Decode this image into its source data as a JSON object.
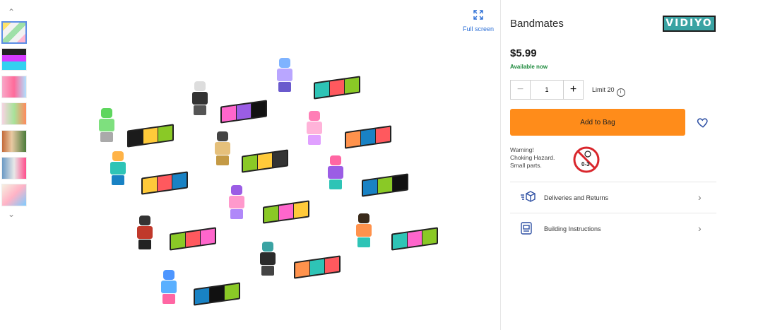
{
  "gallery": {
    "thumbnails": [
      "thumb-1",
      "thumb-2",
      "thumb-3",
      "thumb-4",
      "thumb-5",
      "thumb-6",
      "thumb-7"
    ],
    "up_arrow": "^",
    "down_arrow": "v",
    "fullscreen_label": "Full screen"
  },
  "product": {
    "title": "Bandmates",
    "brand_logo_text": "VIDIYO",
    "price": "$5.99",
    "availability": "Available now",
    "quantity": "1",
    "limit_text": "Limit 20",
    "add_to_bag_label": "Add to Bag",
    "warning_lines": [
      "Warning!",
      "Choking Hazard.",
      "Small parts."
    ],
    "hazard_age_label": "0-3"
  },
  "links": [
    {
      "label": "Deliveries and Returns",
      "icon": "delivery-box-icon"
    },
    {
      "label": "Building Instructions",
      "icon": "instructions-book-icon"
    }
  ],
  "colors": {
    "accent": "#ff8c1a",
    "available": "#1e8a3d",
    "link": "#2d6fd6",
    "brand": "#3aa3a3"
  }
}
